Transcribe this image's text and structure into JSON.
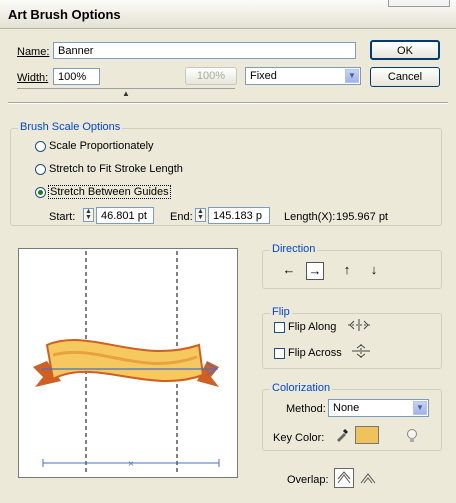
{
  "dialog": {
    "title": "Art Brush Options"
  },
  "name_field": {
    "label": "Name:",
    "value": "Banner"
  },
  "width_field": {
    "label": "Width:",
    "value": "100%"
  },
  "width_mode": {
    "selected": "Fixed"
  },
  "disabled_button_label": "100%",
  "buttons": {
    "ok": "OK",
    "cancel": "Cancel"
  },
  "brush_scale": {
    "title": "Brush Scale Options",
    "options": [
      {
        "label": "Scale Proportionately",
        "selected": false
      },
      {
        "label": "Stretch to Fit Stroke Length",
        "selected": false
      },
      {
        "label": "Stretch Between Guides",
        "selected": true
      }
    ],
    "start_label": "Start:",
    "start_value": "46.801 pt",
    "end_label": "End:",
    "end_value": "145.183 p",
    "length_label": "Length(X):",
    "length_value": "195.967 pt"
  },
  "direction": {
    "title": "Direction",
    "arrows": [
      "←",
      "→",
      "↑",
      "↓"
    ],
    "selected_index": 1
  },
  "flip": {
    "title": "Flip",
    "along": "Flip Along",
    "across": "Flip Across"
  },
  "colorization": {
    "title": "Colorization",
    "method_label": "Method:",
    "method_value": "None",
    "key_color_label": "Key Color:",
    "key_color_hex": "#f0c25a"
  },
  "overlap": {
    "label": "Overlap:"
  },
  "colors": {
    "dialog_bg": "#ece9d8",
    "group_title": "#0046d5",
    "guide_line": "#000000",
    "banner_light": "#f6c95f",
    "banner_dark": "#d05f22"
  }
}
